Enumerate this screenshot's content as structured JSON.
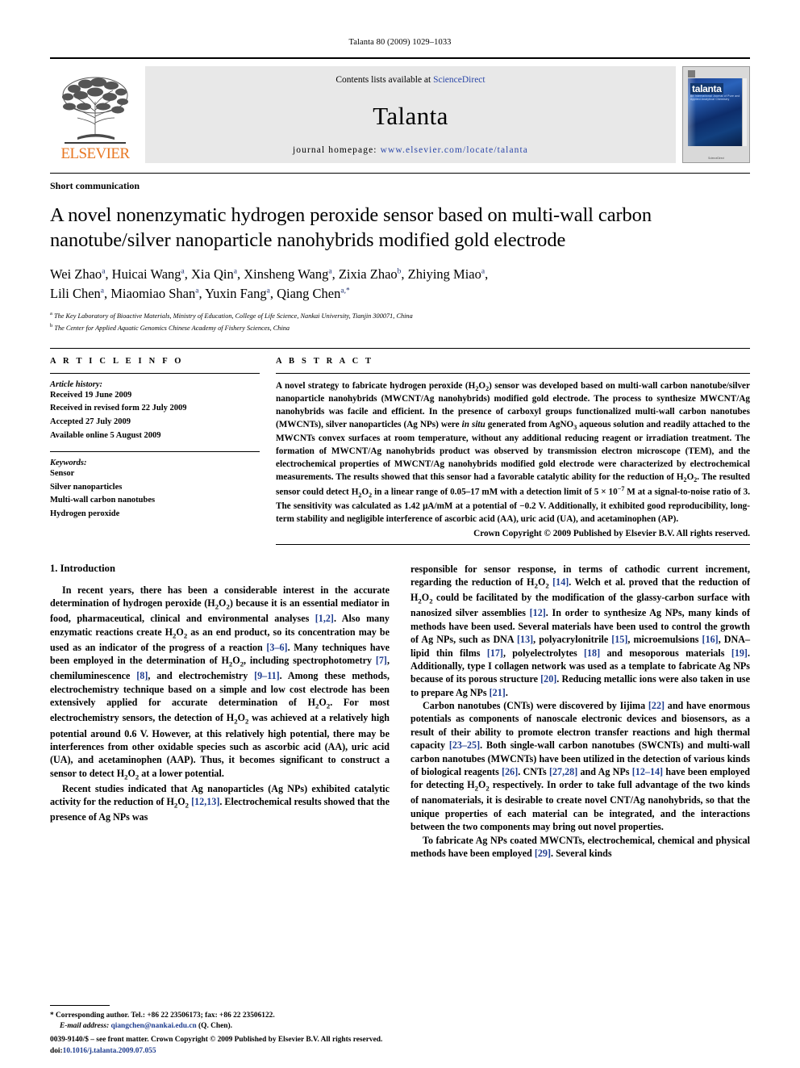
{
  "running_head": "Talanta 80 (2009) 1029–1033",
  "masthead": {
    "contents_prefix": "Contents lists available at ",
    "sciencedirect": "ScienceDirect",
    "journal_title": "Talanta",
    "homepage_prefix": "journal homepage:",
    "homepage_url": "www.elsevier.com/locate/talanta",
    "publisher": "ELSEVIER",
    "cover_title": "talanta",
    "cover_subtitle": "An International Journal of Pure and Applied Analytical Chemistry",
    "cover_footer": "ScienceDirect"
  },
  "article": {
    "type": "Short communication",
    "title": "A novel nonenzymatic hydrogen peroxide sensor based on multi-wall carbon nanotube/silver nanoparticle nanohybrids modified gold electrode",
    "authors_line1": "Wei Zhao<sup>a</sup>, Huicai Wang<sup>a</sup>, Xia Qin<sup>a</sup>, Xinsheng Wang<sup>a</sup>, Zixia Zhao<sup>b</sup>, Zhiying Miao<sup>a</sup>,",
    "authors_line2": "Lili Chen<sup>a</sup>, Miaomiao Shan<sup>a</sup>, Yuxin Fang<sup>a</sup>, Qiang Chen<sup>a,</sup><sup>*</sup>",
    "affiliation_a": "<sup>a</sup> The Key Laboratory of Bioactive Materials, Ministry of Education, College of Life Science, Nankai University, Tianjin 300071, China",
    "affiliation_b": "<sup>b</sup> The Center for Applied Aquatic Genomics Chinese Academy of Fishery Sciences, China"
  },
  "article_info": {
    "heading": "A R T I C L E    I N F O",
    "history_label": "Article history:",
    "history": [
      "Received 19 June 2009",
      "Received in revised form 22 July 2009",
      "Accepted 27 July 2009",
      "Available online 5 August 2009"
    ],
    "keywords_label": "Keywords:",
    "keywords": [
      "Sensor",
      "Silver nanoparticles",
      "Multi-wall carbon nanotubes",
      "Hydrogen peroxide"
    ]
  },
  "abstract": {
    "heading": "A B S T R A C T",
    "text": "A novel strategy to fabricate hydrogen peroxide (H<sub>2</sub>O<sub>2</sub>) sensor was developed based on multi-wall carbon nanotube/silver nanoparticle nanohybrids (MWCNT/Ag nanohybrids) modified gold electrode. The process to synthesize MWCNT/Ag nanohybrids was facile and efficient. In the presence of carboxyl groups functionalized multi-wall carbon nanotubes (MWCNTs), silver nanoparticles (Ag NPs) were <i>in situ</i> generated from AgNO<sub>3</sub> aqueous solution and readily attached to the MWCNTs convex surfaces at room temperature, without any additional reducing reagent or irradiation treatment. The formation of MWCNT/Ag nanohybrids product was observed by transmission electron microscope (TEM), and the electrochemical properties of MWCNT/Ag nanohybrids modified gold electrode were characterized by electrochemical measurements. The results showed that this sensor had a favorable catalytic ability for the reduction of H<sub>2</sub>O<sub>2</sub>. The resulted sensor could detect H<sub>2</sub>O<sub>2</sub> in a linear range of 0.05–17 mM with a detection limit of 5 &times; 10<sup>−7</sup> M at a signal-to-noise ratio of 3. The sensitivity was calculated as 1.42 &mu;A/mM at a potential of −0.2 V. Additionally, it exhibited good reproducibility, long-term stability and negligible interference of ascorbic acid (AA), uric acid (UA), and acetaminophen (AP).",
    "copyright": "Crown Copyright © 2009 Published by Elsevier B.V. All rights reserved."
  },
  "introduction": {
    "heading": "1.  Introduction",
    "left_p1": "In recent years, there has been a considerable interest in the accurate determination of hydrogen peroxide (H<sub>2</sub>O<sub>2</sub>) because it is an essential mediator in food, pharmaceutical, clinical and environmental analyses <span class=\"ref\">[1,2]</span>. Also many enzymatic reactions create H<sub>2</sub>O<sub>2</sub> as an end product, so its concentration may be used as an indicator of the progress of a reaction <span class=\"ref\">[3–6]</span>. Many techniques have been employed in the determination of H<sub>2</sub>O<sub>2</sub>, including spectrophotometry <span class=\"ref\">[7]</span>, chemiluminescence <span class=\"ref\">[8]</span>, and electrochemistry <span class=\"ref\">[9–11]</span>. Among these methods, electrochemistry technique based on a simple and low cost electrode has been extensively applied for accurate determination of H<sub>2</sub>O<sub>2</sub>. For most electrochemistry sensors, the detection of H<sub>2</sub>O<sub>2</sub> was achieved at a relatively high potential around 0.6 V. However, at this relatively high potential, there may be interferences from other oxidable species such as ascorbic acid (AA), uric acid (UA), and acetaminophen (AAP). Thus, it becomes significant to construct a sensor to detect H<sub>2</sub>O<sub>2</sub> at a lower potential.",
    "left_p2": "Recent studies indicated that Ag nanoparticles (Ag NPs) exhibited catalytic activity for the reduction of H<sub>2</sub>O<sub>2</sub> <span class=\"ref\">[12,13]</span>. Electrochemical results showed that the presence of Ag NPs was",
    "right_p1": "responsible for sensor response, in terms of cathodic current increment, regarding the reduction of H<sub>2</sub>O<sub>2</sub> <span class=\"ref\">[14]</span>. Welch et al. proved that the reduction of H<sub>2</sub>O<sub>2</sub> could be facilitated by the modification of the glassy-carbon surface with nanosized silver assemblies <span class=\"ref\">[12]</span>. In order to synthesize Ag NPs, many kinds of methods have been used. Several materials have been used to control the growth of Ag NPs, such as DNA <span class=\"ref\">[13]</span>, polyacrylonitrile <span class=\"ref\">[15]</span>, microemulsions <span class=\"ref\">[16]</span>, DNA–lipid thin films <span class=\"ref\">[17]</span>, polyelectrolytes <span class=\"ref\">[18]</span> and mesoporous materials <span class=\"ref\">[19]</span>. Additionally, type I collagen network was used as a template to fabricate Ag NPs because of its porous structure <span class=\"ref\">[20]</span>. Reducing metallic ions were also taken in use to prepare Ag NPs <span class=\"ref\">[21]</span>.",
    "right_p2": "Carbon nanotubes (CNTs) were discovered by Iijima <span class=\"ref\">[22]</span> and have enormous potentials as components of nanoscale electronic devices and biosensors, as a result of their ability to promote electron transfer reactions and high thermal capacity <span class=\"ref\">[23–25]</span>. Both single-wall carbon nanotubes (SWCNTs) and multi-wall carbon nanotubes (MWCNTs) have been utilized in the detection of various kinds of biological reagents <span class=\"ref\">[26]</span>. CNTs <span class=\"ref\">[27,28]</span> and Ag NPs <span class=\"ref\">[12–14]</span> have been employed for detecting H<sub>2</sub>O<sub>2</sub> respectively. In order to take full advantage of the two kinds of nanomaterials, it is desirable to create novel CNT/Ag nanohybrids, so that the unique properties of each material can be integrated, and the interactions between the two components may bring out novel properties.",
    "right_p3": "To fabricate Ag NPs coated MWCNTs, electrochemical, chemical and physical methods have been employed <span class=\"ref\">[29]</span>. Several kinds"
  },
  "footnote": {
    "marker": "*",
    "corresponding": "Corresponding author. Tel.: +86 22 23506173; fax: +86 22 23506122.",
    "email_label": "E-mail address:",
    "email": "qiangchen@nankai.edu.cn",
    "email_suffix": " (Q. Chen)."
  },
  "bottom_matter": {
    "issn_line": "0039-9140/$ – see front matter. Crown Copyright © 2009 Published by Elsevier B.V. All rights reserved.",
    "doi_label": "doi:",
    "doi_value": "10.1016/j.talanta.2009.07.055"
  }
}
